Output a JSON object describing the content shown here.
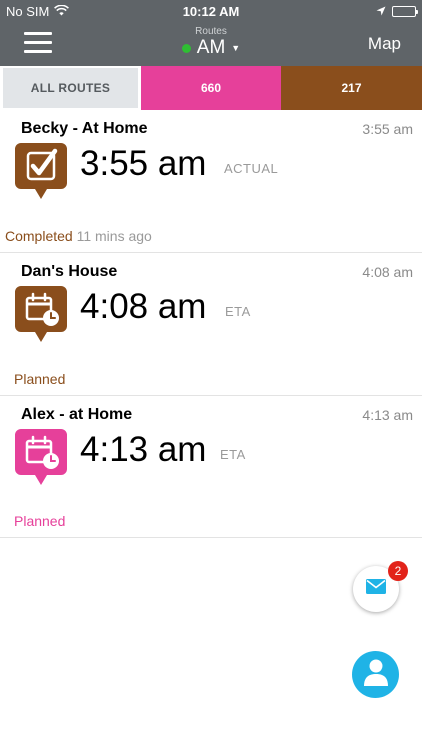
{
  "status_bar": {
    "carrier": "No SIM",
    "time": "10:12 AM"
  },
  "nav": {
    "route_caption": "Routes",
    "route_value": "AM",
    "route_status_color": "#2fbe33",
    "map_label": "Map"
  },
  "tabs": [
    {
      "label": "ALL ROUTES",
      "color": "#e2e5e8"
    },
    {
      "label": "660",
      "color": "#e6409a"
    },
    {
      "label": "217",
      "color": "#8a4e1c"
    }
  ],
  "stops": [
    {
      "name": "Becky - At Home",
      "time_small": "3:55 am",
      "time": "3:55 am",
      "kind": "ACTUAL",
      "status": "Completed",
      "status_detail": "11 mins ago",
      "icon": "checkmark-icon",
      "color": "#8a4e1c"
    },
    {
      "name": "Dan's House",
      "time_small": "4:08 am",
      "time": "4:08 am",
      "kind": "ETA",
      "status": "Planned",
      "status_detail": "",
      "icon": "calendar-clock-icon",
      "color": "#8a4e1c"
    },
    {
      "name": "Alex - at Home",
      "time_small": "4:13 am",
      "time": "4:13 am",
      "kind": "ETA",
      "status": "Planned",
      "status_detail": "",
      "icon": "calendar-clock-icon",
      "color": "#e6409a"
    }
  ],
  "fab": {
    "mail_badge": "2",
    "mail_icon": "envelope-icon",
    "person_icon": "person-icon",
    "accent": "#1fb3e6"
  }
}
